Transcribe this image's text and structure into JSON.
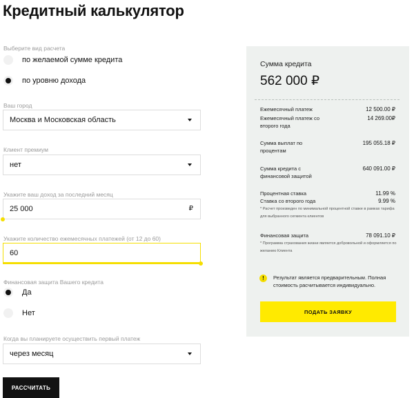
{
  "page": {
    "title": "Кредитный калькулятор"
  },
  "form": {
    "calc_type": {
      "label": "Выберите вид расчета",
      "options": [
        {
          "label": "по желаемой сумме кредита",
          "checked": false
        },
        {
          "label": "по уровню дохода",
          "checked": true
        }
      ]
    },
    "city": {
      "label": "Ваш город",
      "value": "Москва и Московская область"
    },
    "premium": {
      "label": "Клиент премиум",
      "value": "нет"
    },
    "income": {
      "label": "Укажите ваш доход за последний месяц",
      "value": "25 000",
      "suffix": "₽"
    },
    "payments": {
      "label": "Укажите количество ежемесячных платежей (от 12 до 60)",
      "value": "60",
      "slider_fraction": 1.0
    },
    "protection": {
      "label": "Финансовая защита Вашего кредита",
      "options": [
        {
          "label": "Да",
          "checked": true
        },
        {
          "label": "Нет",
          "checked": false
        }
      ]
    },
    "first_payment": {
      "label": "Когда вы планируете осуществить первый платеж",
      "value": "через месяц"
    },
    "calc_button": "РАССЧИТАТЬ"
  },
  "summary": {
    "sum_label": "Сумма кредита",
    "sum_value": "562 000 ₽",
    "monthly_label": "Ежемесячный платеж",
    "monthly_value": "12 500.00 ₽",
    "monthly2_label": "Ежемесячный платеж со второго года",
    "monthly2_value": "14 269.00₽",
    "interest_label": "Сумма выплат по процентам",
    "interest_value": "195 055.18 ₽",
    "protected_label": "Сумма кредита с финансовой защитой",
    "protected_value": "640 091.00 ₽",
    "rate_label": "Процентная ставка",
    "rate_value": "11.99 %",
    "rate2_label": "Ставка со второго года",
    "rate2_value": "9.99 %",
    "rate_note": "* Расчет произведен по минимальной процентной ставке в рамках тарифа для выбранного сегмента клиентов",
    "fin_label": "Финансовая защита",
    "fin_value": "78 091.10 ₽",
    "fin_note": "* Программа страхования жизни является добровольной и оформляется по желанию Клиента",
    "warn_icon": "!",
    "warning": "Результат является предварительным. Полная стоимость расчитывается индивидуально.",
    "apply_button": "ПОДАТЬ ЗАЯВКУ"
  },
  "colors": {
    "accent": "#ffea00",
    "panel_bg": "#eef1ef",
    "dark_button": "#121212"
  }
}
